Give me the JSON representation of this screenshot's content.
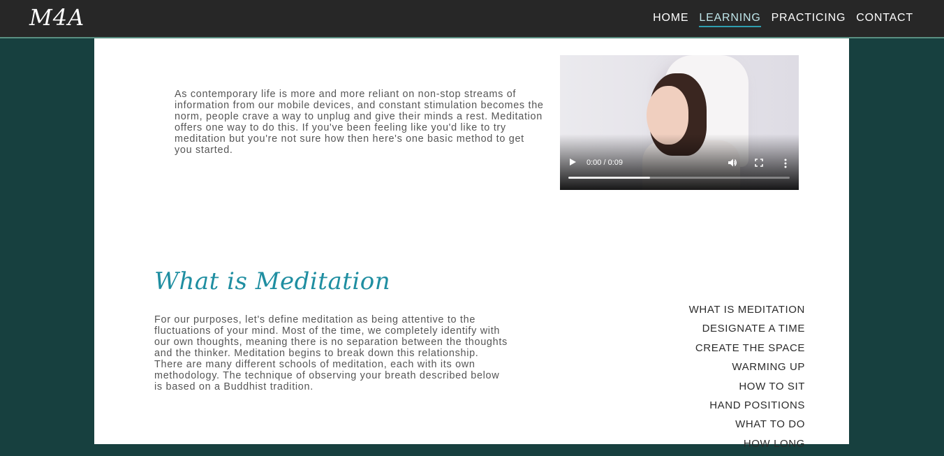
{
  "brand": {
    "logo": "M4A"
  },
  "nav": {
    "items": [
      {
        "label": "HOME",
        "active": false
      },
      {
        "label": "LEARNING",
        "active": true
      },
      {
        "label": "PRACTICING",
        "active": false
      },
      {
        "label": "CONTACT",
        "active": false
      }
    ]
  },
  "intro": {
    "text": "As contemporary life is more and more reliant on non-stop streams of information from our mobile devices, and constant stimulation becomes the norm, people crave a way to unplug and give their minds a rest. Meditation offers one way to do this. If you've been feeling like you'd like to try meditation but you're not sure how then here's one basic method to get you started."
  },
  "video": {
    "time": "0:00 / 0:09",
    "progress_fraction": 0.37,
    "icons": [
      "play-icon",
      "volume-icon",
      "fullscreen-icon",
      "more-options-icon"
    ]
  },
  "section": {
    "title": "What is Meditation",
    "text": "For our purposes, let's define meditation as being attentive to the fluctuations of your mind. Most of the time, we completely identify with our own thoughts, meaning there is no separation between the thoughts and the thinker. Meditation begins to break down this relationship. There are many different schools of meditation, each with its own methodology. The technique of observing your breath described below is based on a Buddhist tradition."
  },
  "toc": {
    "items": [
      "WHAT IS MEDITATION",
      "DESIGNATE A TIME",
      "CREATE THE SPACE",
      "WARMING UP",
      "HOW TO SIT",
      "HAND POSITIONS",
      "WHAT TO DO",
      "HOW LONG"
    ]
  },
  "colors": {
    "navbar": "#272727",
    "background": "#17403f",
    "accent": "#1f8ea1",
    "content": "#ffffff"
  }
}
